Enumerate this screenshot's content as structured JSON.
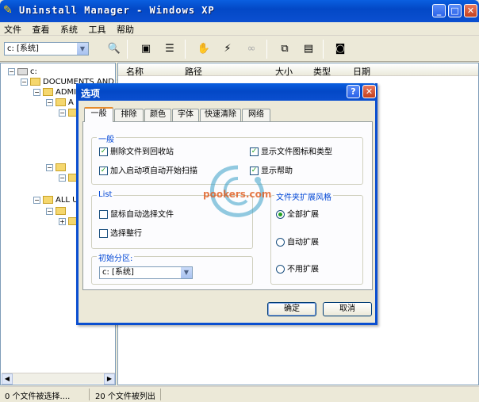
{
  "window": {
    "title": "Uninstall Manager - Windows XP"
  },
  "menu": [
    "文件",
    "查看",
    "系统",
    "工具",
    "帮助"
  ],
  "toolbar": {
    "drive": "c: [系统]"
  },
  "tree": [
    {
      "label": "c:",
      "indent": 0
    },
    {
      "label": "DOCUMENTS AND S",
      "indent": 1
    },
    {
      "label": "ADMI",
      "indent": 2
    },
    {
      "label": "A",
      "indent": 3
    },
    {
      "label": "",
      "indent": 4
    },
    {
      "label": "",
      "indent": 3
    },
    {
      "label": "",
      "indent": 4
    },
    {
      "label": "ALL U",
      "indent": 1
    },
    {
      "label": "",
      "indent": 2
    },
    {
      "label": "",
      "indent": 3
    }
  ],
  "columns": {
    "name": "名称",
    "path": "路径",
    "size": "大小",
    "type": "类型",
    "date": "日期"
  },
  "status": {
    "selected": "0 个文件被选择....",
    "found": "20 个文件被列出"
  },
  "dialog": {
    "title": "选项",
    "tabs": [
      "一般",
      "排除",
      "颜色",
      "字体",
      "快速清除",
      "网络"
    ],
    "general": {
      "label": "一般",
      "recycle": "删除文件到回收站",
      "autostart": "加入启动项自动开始扫描",
      "showicons": "显示文件图标和类型",
      "showhelp": "显示帮助"
    },
    "list": {
      "label": "List",
      "autoselect": "鼠标自动选择文件",
      "fullrow": "选择整行"
    },
    "startdrive": {
      "label": "初始分区:",
      "value": "c: [系统]"
    },
    "folderstyle": {
      "label": "文件夹扩展风格",
      "all": "全部扩展",
      "auto": "自动扩展",
      "none": "不用扩展"
    },
    "ok": "确定",
    "cancel": "取消"
  },
  "watermark": {
    "text": "pookers.com"
  },
  "colors": {
    "titlebar": "#0b4fd0",
    "checkmark": "#21a121",
    "watermark": "#e05a1c"
  }
}
